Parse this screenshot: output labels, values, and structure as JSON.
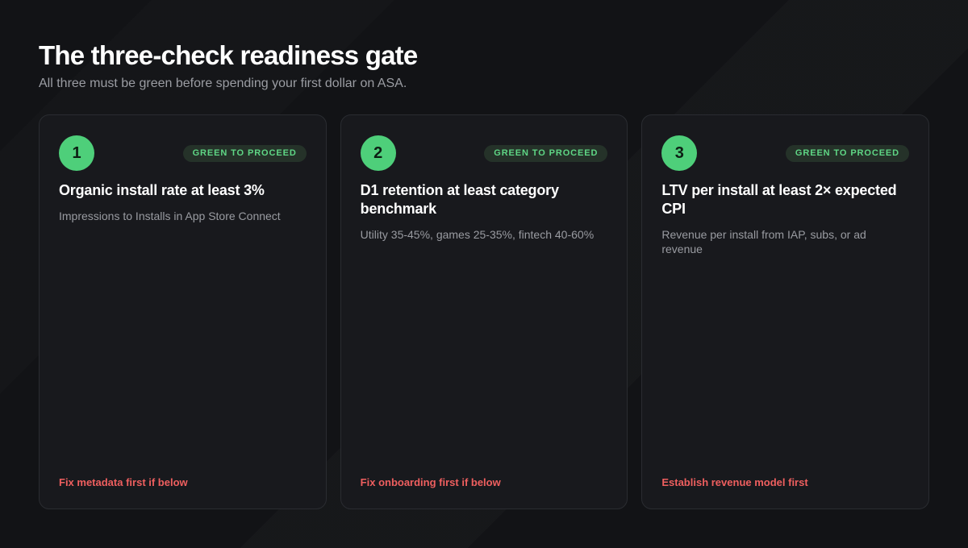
{
  "header": {
    "title": "The three-check readiness gate",
    "subtitle": "All three must be green before spending your first dollar on ASA."
  },
  "colors": {
    "background": "#121316",
    "card": "#18191d",
    "accent_green": "#4ecf7a",
    "warning_red": "#ef5f5f"
  },
  "checks": [
    {
      "number": "1",
      "status": "GREEN TO PROCEED",
      "title": "Organic install rate at least 3%",
      "description": "Impressions to Installs in App Store Connect",
      "warning": "Fix metadata first if below"
    },
    {
      "number": "2",
      "status": "GREEN TO PROCEED",
      "title": "D1 retention at least category benchmark",
      "description": "Utility 35-45%, games 25-35%, fintech 40-60%",
      "warning": "Fix onboarding first if below"
    },
    {
      "number": "3",
      "status": "GREEN TO PROCEED",
      "title": "LTV per install at least 2× expected CPI",
      "description": "Revenue per install from IAP, subs, or ad revenue",
      "warning": "Establish revenue model first"
    }
  ]
}
